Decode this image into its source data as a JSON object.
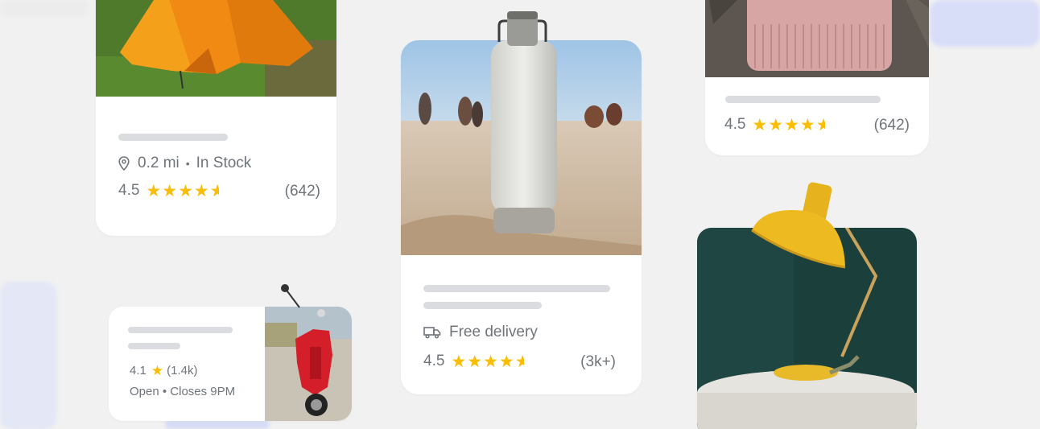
{
  "colors": {
    "background": "#f1f1f1",
    "card": "#ffffff",
    "skeleton": "#dadce0",
    "text": "#70757a",
    "star": "#fbbc04"
  },
  "cards": {
    "tent": {
      "image": "orange-tent-photo",
      "distance": "0.2 mi",
      "separator": "•",
      "stock": "In Stock",
      "rating": "4.5",
      "stars": 4.5,
      "reviews": "(642)"
    },
    "bottle": {
      "image": "water-bottle-on-beach-photo",
      "delivery": "Free delivery",
      "rating": "4.5",
      "stars": 4.5,
      "reviews": "(3k+)"
    },
    "beanie": {
      "image": "pink-beanie-photo",
      "rating": "4.5",
      "stars": 4.5,
      "reviews": "(642)"
    },
    "scooter": {
      "image": "red-scooter-photo",
      "rating": "4.1",
      "stars_shown": 1,
      "reviews": "(1.4k)",
      "hours": "Open • Closes 9PM"
    },
    "lamp": {
      "image": "yellow-desk-lamp-photo"
    }
  }
}
